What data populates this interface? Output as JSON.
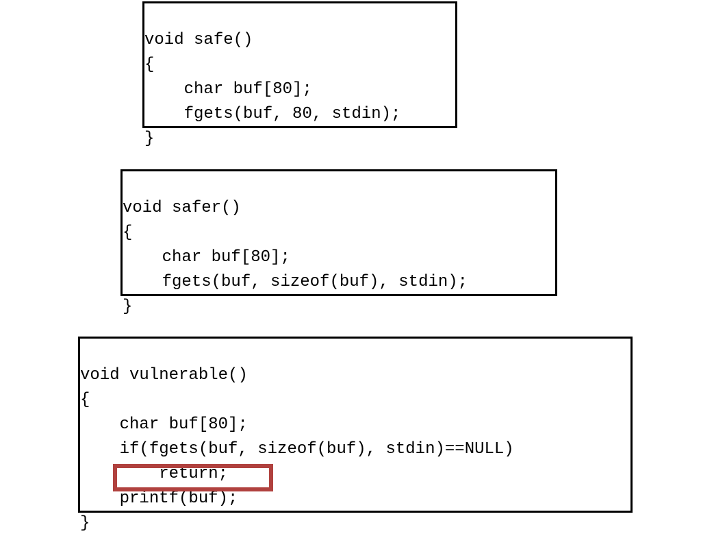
{
  "box1": {
    "line1": "void safe()",
    "line2": "{",
    "line3": "    char buf[80];",
    "line4": "    fgets(buf, 80, stdin);",
    "line5": "}"
  },
  "box2": {
    "line1": "void safer()",
    "line2": "{",
    "line3": "    char buf[80];",
    "line4": "    fgets(buf, sizeof(buf), stdin);",
    "line5": "}"
  },
  "box3": {
    "line1": "void vulnerable()",
    "line2": "{",
    "line3": "    char buf[80];",
    "line4": "    if(fgets(buf, sizeof(buf), stdin)==NULL)",
    "line5": "        return;",
    "line6": "    printf(buf);",
    "line7": "}"
  }
}
